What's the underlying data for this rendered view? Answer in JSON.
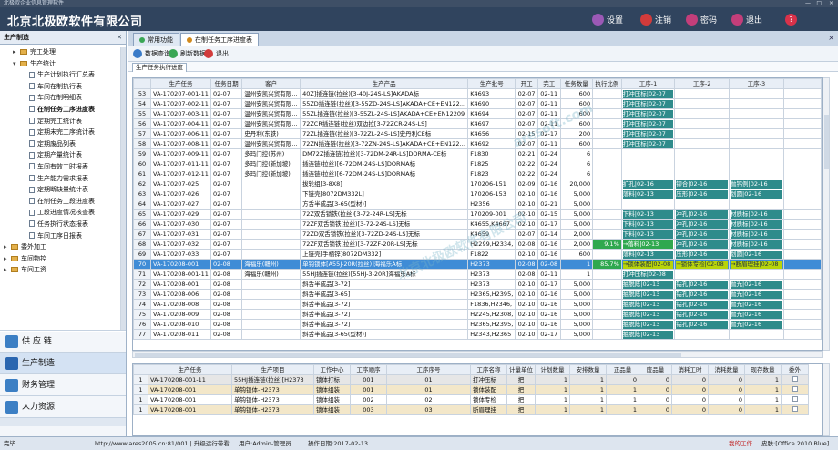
{
  "window": {
    "title": "北极欧企业信息管理软件",
    "controls": [
      "—",
      "□",
      "×"
    ]
  },
  "header": {
    "app_title": "北京北极欧软件有限公司",
    "buttons": [
      {
        "label": "设置",
        "icon": "gear-icon",
        "color": "#9b59b6"
      },
      {
        "label": "注销",
        "icon": "logout-icon",
        "color": "#d23b3b"
      },
      {
        "label": "密码",
        "icon": "key-icon",
        "color": "#c33e7a"
      },
      {
        "label": "退出",
        "icon": "exit-icon",
        "color": "#c33e7a"
      },
      {
        "label": "?",
        "icon": "help-icon",
        "color": "#d9324a"
      }
    ]
  },
  "sidebar": {
    "title": "生产制造",
    "pin": "✕",
    "tree": [
      {
        "label": "完工处理",
        "level": 1,
        "type": "folder",
        "expander": "▸"
      },
      {
        "label": "生产统计",
        "level": 1,
        "type": "folder",
        "expander": "▾"
      },
      {
        "label": "生产计划执行汇总表",
        "level": 2,
        "type": "doc"
      },
      {
        "label": "车间在制执行表",
        "level": 2,
        "type": "doc"
      },
      {
        "label": "车间在制明细表",
        "level": 2,
        "type": "doc"
      },
      {
        "label": "在制任务工序进度表",
        "level": 2,
        "type": "doc",
        "bold": true
      },
      {
        "label": "定期完工统计表",
        "level": 2,
        "type": "doc"
      },
      {
        "label": "定期未完工序统计表",
        "level": 2,
        "type": "doc"
      },
      {
        "label": "定期废品列表",
        "level": 2,
        "type": "doc"
      },
      {
        "label": "定期产量统计表",
        "level": 2,
        "type": "doc"
      },
      {
        "label": "车间有效工时报表",
        "level": 2,
        "type": "doc"
      },
      {
        "label": "生产能力需求报表",
        "level": 2,
        "type": "doc"
      },
      {
        "label": "定期断缺量统计表",
        "level": 2,
        "type": "doc"
      },
      {
        "label": "在制任务工段进度表",
        "level": 2,
        "type": "doc"
      },
      {
        "label": "工段进度情况核查表",
        "level": 2,
        "type": "doc"
      },
      {
        "label": "任务执行状态报表",
        "level": 2,
        "type": "doc"
      },
      {
        "label": "车间工序日报表",
        "level": 2,
        "type": "doc"
      },
      {
        "label": "委外加工",
        "level": 0,
        "type": "folder",
        "expander": "▸"
      },
      {
        "label": "车间物控",
        "level": 0,
        "type": "folder",
        "expander": "▸"
      },
      {
        "label": "车间工资",
        "level": 0,
        "type": "folder",
        "expander": "▸"
      }
    ],
    "modules": [
      {
        "label": "供 应 链",
        "icon": "supply-chain-icon",
        "color": "#3c7fc4",
        "active": false
      },
      {
        "label": "生产制造",
        "icon": "production-icon",
        "color": "#2a66b0",
        "active": true
      },
      {
        "label": "财务管理",
        "icon": "finance-icon",
        "color": "#3c7fc4",
        "active": false
      },
      {
        "label": "人力资源",
        "icon": "hr-icon",
        "color": "#3c7fc4",
        "active": false
      }
    ]
  },
  "tabs": [
    {
      "label": "常用功能",
      "active": false,
      "dot": "#3aa655"
    },
    {
      "label": "在制任务工序进度表",
      "active": true,
      "dot": "#d28a1c"
    }
  ],
  "tab_close": "×",
  "toolbar": [
    {
      "label": "数据查询",
      "icon": "query-icon",
      "color": "#3a7bc8"
    },
    {
      "label": "刷新数据",
      "icon": "refresh-icon",
      "color": "#3aa655"
    },
    {
      "label": "退出",
      "icon": "exit-icon",
      "color": "#d23b3b"
    }
  ],
  "subtab": "生产任务执行进度",
  "grid1": {
    "headers": [
      "",
      "生产任务",
      "任务日期",
      "客户",
      "生产产品",
      "生产批号",
      "开工",
      "完工",
      "任务数量",
      "执行比例",
      "工序-1",
      "工序-2",
      "工序-3"
    ],
    "op_colors": {
      "teal": "#2e8b8b",
      "green": "#2fa84f",
      "yellow": "#b8d40a",
      "sel": "#3f8cd6"
    },
    "rows": [
      {
        "rn": "53",
        "task": "VA-170207-001-11",
        "date": "02-07",
        "cust": "温州安凯兴贸有限…",
        "prod": "40Z]插连链(拉丝)[3-40J-24S-LS]AKADA标",
        "batch": "K4693",
        "start": "02-07",
        "end": "02-11",
        "qty": "600",
        "ratio": "",
        "ops": [
          [
            "打冲压标|02-07",
            "teal"
          ],
          [
            "",
            ""
          ],
          [
            "",
            ""
          ]
        ]
      },
      {
        "rn": "54",
        "task": "VA-170207-002-11",
        "date": "02-07",
        "cust": "温州安凯兴贸有限…",
        "prod": "55ZD插连链(拉丝)[3-55ZD-24S-LS]AKADA+CE+EN122…",
        "batch": "K4690",
        "start": "02-07",
        "end": "02-11",
        "qty": "600",
        "ratio": "",
        "ops": [
          [
            "打冲压标|02-07",
            "teal"
          ],
          [
            "",
            ""
          ],
          [
            "",
            ""
          ]
        ]
      },
      {
        "rn": "55",
        "task": "VA-170207-003-11",
        "date": "02-07",
        "cust": "温州安凯兴贸有限…",
        "prod": "55ZL插连链(拉丝)[3-55ZL-24S-LS]AKADA+CE+EN12209",
        "batch": "K4694",
        "start": "02-07",
        "end": "02-11",
        "qty": "600",
        "ratio": "",
        "ops": [
          [
            "打冲压标|02-07",
            "teal"
          ],
          [
            "",
            ""
          ],
          [
            "",
            ""
          ]
        ]
      },
      {
        "rn": "56",
        "task": "VA-170207-004-11",
        "date": "02-07",
        "cust": "温州安凯兴贸有限…",
        "prod": "72ZCR插连链(拉丝)双边拉[3-72ZCR-24S-LS]",
        "batch": "K4697",
        "start": "02-07",
        "end": "02-11",
        "qty": "600",
        "ratio": "",
        "ops": [
          [
            "打冲压标|02-07",
            "teal"
          ],
          [
            "",
            ""
          ],
          [
            "",
            ""
          ]
        ]
      },
      {
        "rn": "57",
        "task": "VA-170207-006-11",
        "date": "02-07",
        "cust": "史丹利(东铁)",
        "prod": "72ZL插连链(拉丝)[3-72ZL-24S-LS]史丹利CE标",
        "batch": "K4656",
        "start": "02-15",
        "end": "02-17",
        "qty": "200",
        "ratio": "",
        "ops": [
          [
            "打冲压标|02-07",
            "teal"
          ],
          [
            "",
            ""
          ],
          [
            "",
            ""
          ]
        ]
      },
      {
        "rn": "58",
        "task": "VA-170207-008-11",
        "date": "02-07",
        "cust": "温州安凯兴贸有限…",
        "prod": "72ZN插连链(拉丝)[3-72ZN-24S-LS]AKADA+CE+EN122…",
        "batch": "K4692",
        "start": "02-07",
        "end": "02-11",
        "qty": "600",
        "ratio": "",
        "ops": [
          [
            "打冲压标|02-07",
            "teal"
          ],
          [
            "",
            ""
          ],
          [
            "",
            ""
          ]
        ]
      },
      {
        "rn": "59",
        "task": "VA-170207-009-11",
        "date": "02-07",
        "cust": "多玛门控(苏州)",
        "prod": "DM72Z插连链(拉丝)[3-72DM-24R-LS]DORMA-CE标",
        "batch": "F1830",
        "start": "02-21",
        "end": "02-24",
        "qty": "6",
        "ratio": "",
        "ops": [
          [
            "",
            ""
          ],
          [
            "",
            ""
          ],
          [
            "",
            ""
          ]
        ]
      },
      {
        "rn": "60",
        "task": "VA-170207-011-11",
        "date": "02-07",
        "cust": "多玛门控(新加坡)",
        "prod": "插连链(拉丝)[6-72DM-24S-LS]DORMA标",
        "batch": "F1825",
        "start": "02-22",
        "end": "02-24",
        "qty": "6",
        "ratio": "",
        "ops": [
          [
            "",
            ""
          ],
          [
            "",
            ""
          ],
          [
            "",
            ""
          ]
        ]
      },
      {
        "rn": "61",
        "task": "VA-170207-012-11",
        "date": "02-07",
        "cust": "多玛门控(新加坡)",
        "prod": "插连链(拉丝)[6-72DM-24S-LS]DORMA标",
        "batch": "F1823",
        "start": "02-22",
        "end": "02-24",
        "qty": "6",
        "ratio": "",
        "ops": [
          [
            "",
            ""
          ],
          [
            "",
            ""
          ],
          [
            "",
            ""
          ]
        ]
      },
      {
        "rn": "62",
        "task": "VA-170207-025",
        "date": "02-07",
        "cust": "",
        "prod": "拔轮组[3-8X8]",
        "batch": "170206-151",
        "start": "02-09",
        "end": "02-16",
        "qty": "20,000",
        "ratio": "",
        "ops": [
          [
            "扩孔|02-16",
            "teal"
          ],
          [
            "铆合|02-16",
            "teal"
          ],
          [
            "抛钙例|02-16",
            "teal"
          ]
        ]
      },
      {
        "rn": "63",
        "task": "VA-170207-026",
        "date": "02-07",
        "cust": "",
        "prod": "下链壳[8072DM332L]",
        "batch": "170206-153",
        "start": "02-10",
        "end": "02-16",
        "qty": "5,000",
        "ratio": "",
        "ops": [
          [
            "落料|02-13",
            "teal"
          ],
          [
            "压形|02-16",
            "teal"
          ],
          [
            "划圆|02-16",
            "teal"
          ]
        ]
      },
      {
        "rn": "64",
        "task": "VA-170207-027",
        "date": "02-07",
        "cust": "",
        "prod": "方舌半成品[3-65(型材)]",
        "batch": "H2356",
        "start": "02-10",
        "end": "02-21",
        "qty": "5,000",
        "ratio": "",
        "ops": [
          [
            "",
            ""
          ],
          [
            "",
            ""
          ],
          [
            "",
            ""
          ]
        ]
      },
      {
        "rn": "65",
        "task": "VA-170207-029",
        "date": "02-07",
        "cust": "",
        "prod": "72Z双舌锁铁(拉丝)[3-72-24R-LS]无标",
        "batch": "170209-001",
        "start": "02-10",
        "end": "02-15",
        "qty": "5,000",
        "ratio": "",
        "ops": [
          [
            "下料|02-13",
            "teal"
          ],
          [
            "冲孔|02-16",
            "teal"
          ],
          [
            "材质标|02-16",
            "teal"
          ]
        ]
      },
      {
        "rn": "66",
        "task": "VA-170207-030",
        "date": "02-07",
        "cust": "",
        "prod": "72ZF双舌锁铁(拉丝)[3-72-24S-LS]无标",
        "batch": "K4655,K4667",
        "start": "02-10",
        "end": "02-17",
        "qty": "5,000",
        "ratio": "",
        "ops": [
          [
            "下料|02-13",
            "teal"
          ],
          [
            "冲孔|02-16",
            "teal"
          ],
          [
            "材质标|02-16",
            "teal"
          ]
        ]
      },
      {
        "rn": "67",
        "task": "VA-170207-031",
        "date": "02-07",
        "cust": "",
        "prod": "72ZD双舌锁铁(拉丝)[3-72ZD-24S-LS]无标",
        "batch": "K4659",
        "start": "02-07",
        "end": "02-14",
        "qty": "2,000",
        "ratio": "",
        "ops": [
          [
            "下料|02-13",
            "teal"
          ],
          [
            "冲孔|02-16",
            "teal"
          ],
          [
            "材质标|02-16",
            "teal"
          ]
        ]
      },
      {
        "rn": "68",
        "task": "VA-170207-032",
        "date": "02-07",
        "cust": "",
        "prod": "72ZF双舌锁铁(拉丝)[3-72ZF-20R-LS]无标",
        "batch": "H2299,H2334,",
        "start": "02-08",
        "end": "02-16",
        "qty": "2,000",
        "ratio": "9.1%",
        "ops": [
          [
            "→落料|02-13",
            "green"
          ],
          [
            "冲孔|02-16",
            "teal"
          ],
          [
            "材质标|02-16",
            "teal"
          ]
        ]
      },
      {
        "rn": "69",
        "task": "VA-170207-033",
        "date": "02-07",
        "cust": "",
        "prod": "上链壳[手柄锌]8072DM332]",
        "batch": "F1822",
        "start": "02-10",
        "end": "02-16",
        "qty": "600",
        "ratio": "",
        "ops": [
          [
            "落料|02-13",
            "teal"
          ],
          [
            "压形|02-16",
            "teal"
          ],
          [
            "划圆|02-16",
            "teal"
          ]
        ]
      },
      {
        "rn": "70",
        "task": "VA-170208-001",
        "date": "02-08",
        "cust": "海福乐(赣州)",
        "prod": "单钩锁体[A55J-20R(拉丝)]海福乐A标",
        "batch": "H2373",
        "start": "02-08",
        "end": "02-08",
        "qty": "1",
        "ratio": "85.7%",
        "sel": true,
        "ops": [
          [
            "→锁体装配|02-08",
            "yellow"
          ],
          [
            "→锁体专检|02-08",
            "yellow"
          ],
          [
            "→断眉理挂|02-08",
            "yellow"
          ]
        ]
      },
      {
        "rn": "71",
        "task": "VA-170208-001-11",
        "date": "02-08",
        "cust": "海福乐(赣州)",
        "prod": "55HJ插连链(拉丝)[55HJ-3-20R]海福乐A标",
        "batch": "H2373",
        "start": "02-08",
        "end": "02-11",
        "qty": "1",
        "ratio": "",
        "ops": [
          [
            "打冲压标|02-08",
            "teal"
          ],
          [
            "",
            ""
          ],
          [
            "",
            ""
          ]
        ]
      },
      {
        "rn": "72",
        "task": "VA-170208-001",
        "date": "02-08",
        "cust": "",
        "prod": "斜舌半成品[3-72]",
        "batch": "H2373",
        "start": "02-10",
        "end": "02-17",
        "qty": "5,000",
        "ratio": "",
        "ops": [
          [
            "抽脱陈|02-13",
            "teal"
          ],
          [
            "钻孔|02-16",
            "teal"
          ],
          [
            "抛光|02-16",
            "teal"
          ]
        ]
      },
      {
        "rn": "73",
        "task": "VA-170208-006",
        "date": "02-08",
        "cust": "",
        "prod": "斜舌半成品[3-65]",
        "batch": "H2365,H2395,",
        "start": "02-10",
        "end": "02-16",
        "qty": "5,000",
        "ratio": "",
        "ops": [
          [
            "抽脱陈|02-13",
            "teal"
          ],
          [
            "钻孔|02-16",
            "teal"
          ],
          [
            "抛光|02-16",
            "teal"
          ]
        ]
      },
      {
        "rn": "74",
        "task": "VA-170208-008",
        "date": "02-08",
        "cust": "",
        "prod": "斜舌半成品[3-72]",
        "batch": "F1836,H2346,",
        "start": "02-10",
        "end": "02-16",
        "qty": "5,000",
        "ratio": "",
        "ops": [
          [
            "抽脱陈|02-13",
            "teal"
          ],
          [
            "钻孔|02-16",
            "teal"
          ],
          [
            "抛光|02-16",
            "teal"
          ]
        ]
      },
      {
        "rn": "75",
        "task": "VA-170208-009",
        "date": "02-08",
        "cust": "",
        "prod": "斜舌半成品[3-72]",
        "batch": "H2245,H2308,",
        "start": "02-10",
        "end": "02-16",
        "qty": "5,000",
        "ratio": "",
        "ops": [
          [
            "抽脱陈|02-13",
            "teal"
          ],
          [
            "钻孔|02-16",
            "teal"
          ],
          [
            "抛光|02-16",
            "teal"
          ]
        ]
      },
      {
        "rn": "76",
        "task": "VA-170208-010",
        "date": "02-08",
        "cust": "",
        "prod": "斜舌半成品[3-72]",
        "batch": "H2365,H2395,",
        "start": "02-10",
        "end": "02-16",
        "qty": "5,000",
        "ratio": "",
        "ops": [
          [
            "抽脱陈|02-13",
            "teal"
          ],
          [
            "钻孔|02-16",
            "teal"
          ],
          [
            "抛光|02-16",
            "teal"
          ]
        ]
      },
      {
        "rn": "77",
        "task": "VA-170208-011",
        "date": "02-08",
        "cust": "",
        "prod": "斜舌半成品[3-65(型材)]",
        "batch": "H2343,H2365",
        "start": "02-10",
        "end": "02-17",
        "qty": "5,000",
        "ratio": "",
        "ops": [
          [
            "抽脱陈|02-13",
            "teal"
          ],
          [
            "",
            ""
          ],
          [
            "",
            ""
          ]
        ]
      }
    ]
  },
  "grid2": {
    "headers": [
      "",
      "生产任务",
      "生产项目",
      "工作中心",
      "工序顺序",
      "工序序号",
      "工序名称",
      "计量单位",
      "计划数量",
      "安排数量",
      "正品量",
      "废品量",
      "消耗工时",
      "消耗数量",
      "现存数量",
      "委外"
    ],
    "rows": [
      {
        "rn": "1",
        "task": "VA-170208-001-11",
        "item": "55HJ插连链(拉丝)[H2373",
        "wc": "锁体打标",
        "seq": "001",
        "no": "01",
        "op": "打冲压标",
        "unit": "把",
        "plan": "1",
        "arr": "1",
        "good": "0",
        "bad": "0",
        "hrs": "0",
        "cons": "0",
        "stock": "1",
        "tint": "#e6e6e6"
      },
      {
        "rn": "1",
        "task": "VA-170208-001",
        "item": "单钩锁体-H2373",
        "wc": "锁体组装",
        "seq": "001",
        "no": "01",
        "op": "锁体装配",
        "unit": "把",
        "plan": "1",
        "arr": "1",
        "good": "1",
        "bad": "0",
        "hrs": "0",
        "cons": "0",
        "stock": "1",
        "tint": "#f3e7c9"
      },
      {
        "rn": "1",
        "task": "VA-170208-001",
        "item": "单钩锁体-H2373",
        "wc": "锁体组装",
        "seq": "002",
        "no": "02",
        "op": "锁体专检",
        "unit": "把",
        "plan": "1",
        "arr": "1",
        "good": "1",
        "bad": "0",
        "hrs": "0",
        "cons": "0",
        "stock": "1",
        "tint": "#fff"
      },
      {
        "rn": "1",
        "task": "VA-170208-001",
        "item": "单钩锁体-H2373",
        "wc": "锁体组装",
        "seq": "003",
        "no": "03",
        "op": "断眉理挂",
        "unit": "把",
        "plan": "1",
        "arr": "1",
        "good": "1",
        "bad": "0",
        "hrs": "0",
        "cons": "0",
        "stock": "1",
        "tint": "#f3e7c9"
      }
    ]
  },
  "status": {
    "left": "完毕",
    "url": "http://www.ares2005.cn:81/001 | 升级运行带看",
    "user": "用户:Admin-管理员",
    "date": "操作日期:2017-02-13",
    "work": "我的工作",
    "skin": "皮肤:[Office 2010 Blue]"
  },
  "watermarks": [
    "aresoft.com",
    "北京北极欧软件有限公司"
  ]
}
